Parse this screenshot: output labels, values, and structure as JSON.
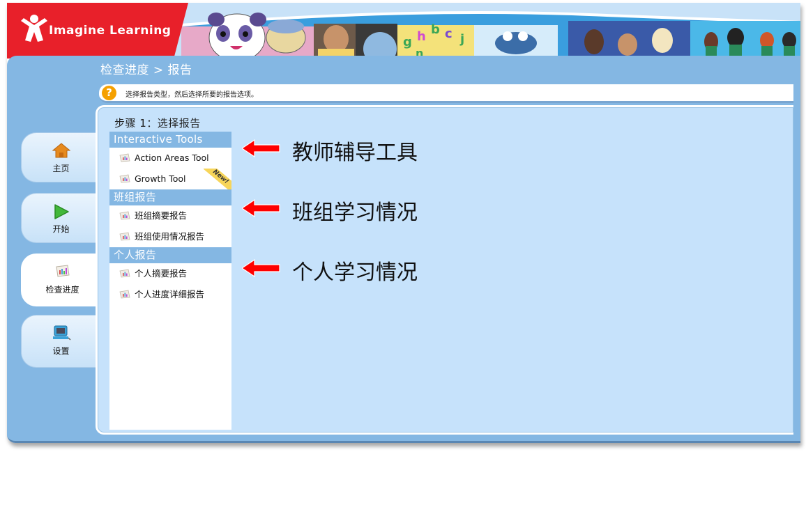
{
  "brand": {
    "name": "Imagine Learning"
  },
  "breadcrumb": "检查进度 > 报告",
  "hint": {
    "icon": "question-icon",
    "icon_glyph": "?",
    "text": "选择报告类型，然后选择所要的报告选项。"
  },
  "nav": [
    {
      "id": "home",
      "label": "主页",
      "icon": "home-icon",
      "active": false
    },
    {
      "id": "start",
      "label": "开始",
      "icon": "play-icon",
      "active": false
    },
    {
      "id": "progress",
      "label": "检查进度",
      "icon": "chart-icon",
      "active": true
    },
    {
      "id": "settings",
      "label": "设置",
      "icon": "computer-icon",
      "active": false
    }
  ],
  "step": {
    "title": "步骤 1：选择报告"
  },
  "reports": {
    "sections": [
      {
        "heading": "Interactive Tools",
        "items": [
          {
            "label": "Action Areas Tool"
          },
          {
            "label": "Growth Tool",
            "badge": "New!"
          }
        ]
      },
      {
        "heading": "班组报告",
        "items": [
          {
            "label": "班组摘要报告"
          },
          {
            "label": "班组使用情况报告"
          }
        ]
      },
      {
        "heading": "个人报告",
        "items": [
          {
            "label": "个人摘要报告"
          },
          {
            "label": "个人进度详细报告"
          }
        ]
      }
    ]
  },
  "annotations": [
    {
      "text": "教师辅导工具",
      "color": "#ff0000"
    },
    {
      "text": "班组学习情况",
      "color": "#ff0000"
    },
    {
      "text": "个人学习情况",
      "color": "#ff0000"
    }
  ],
  "colors": {
    "brand_red": "#e8202a",
    "frame_blue": "#84b7e3",
    "panel_blue": "#c6e2fb",
    "hint_orange": "#f5a000"
  }
}
